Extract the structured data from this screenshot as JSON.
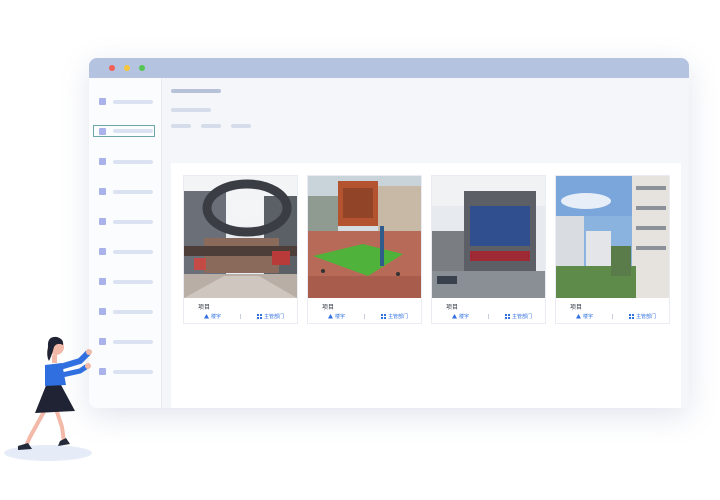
{
  "cards": [
    {
      "title": "项目",
      "tag_building": "楼宇",
      "tag_dept": "主管部门"
    },
    {
      "title": "项目",
      "tag_building": "楼宇",
      "tag_dept": "主管部门"
    },
    {
      "title": "项目",
      "tag_building": "楼宇",
      "tag_dept": "主管部门"
    },
    {
      "title": "项目",
      "tag_building": "楼宇",
      "tag_dept": "主管部门"
    }
  ],
  "colors": {
    "titlebar": "#b4c3e0",
    "accent": "#2f6fe0",
    "sidebar_icon": "#a9b2ea"
  },
  "icons": [
    "building-icon",
    "grid-icon"
  ]
}
